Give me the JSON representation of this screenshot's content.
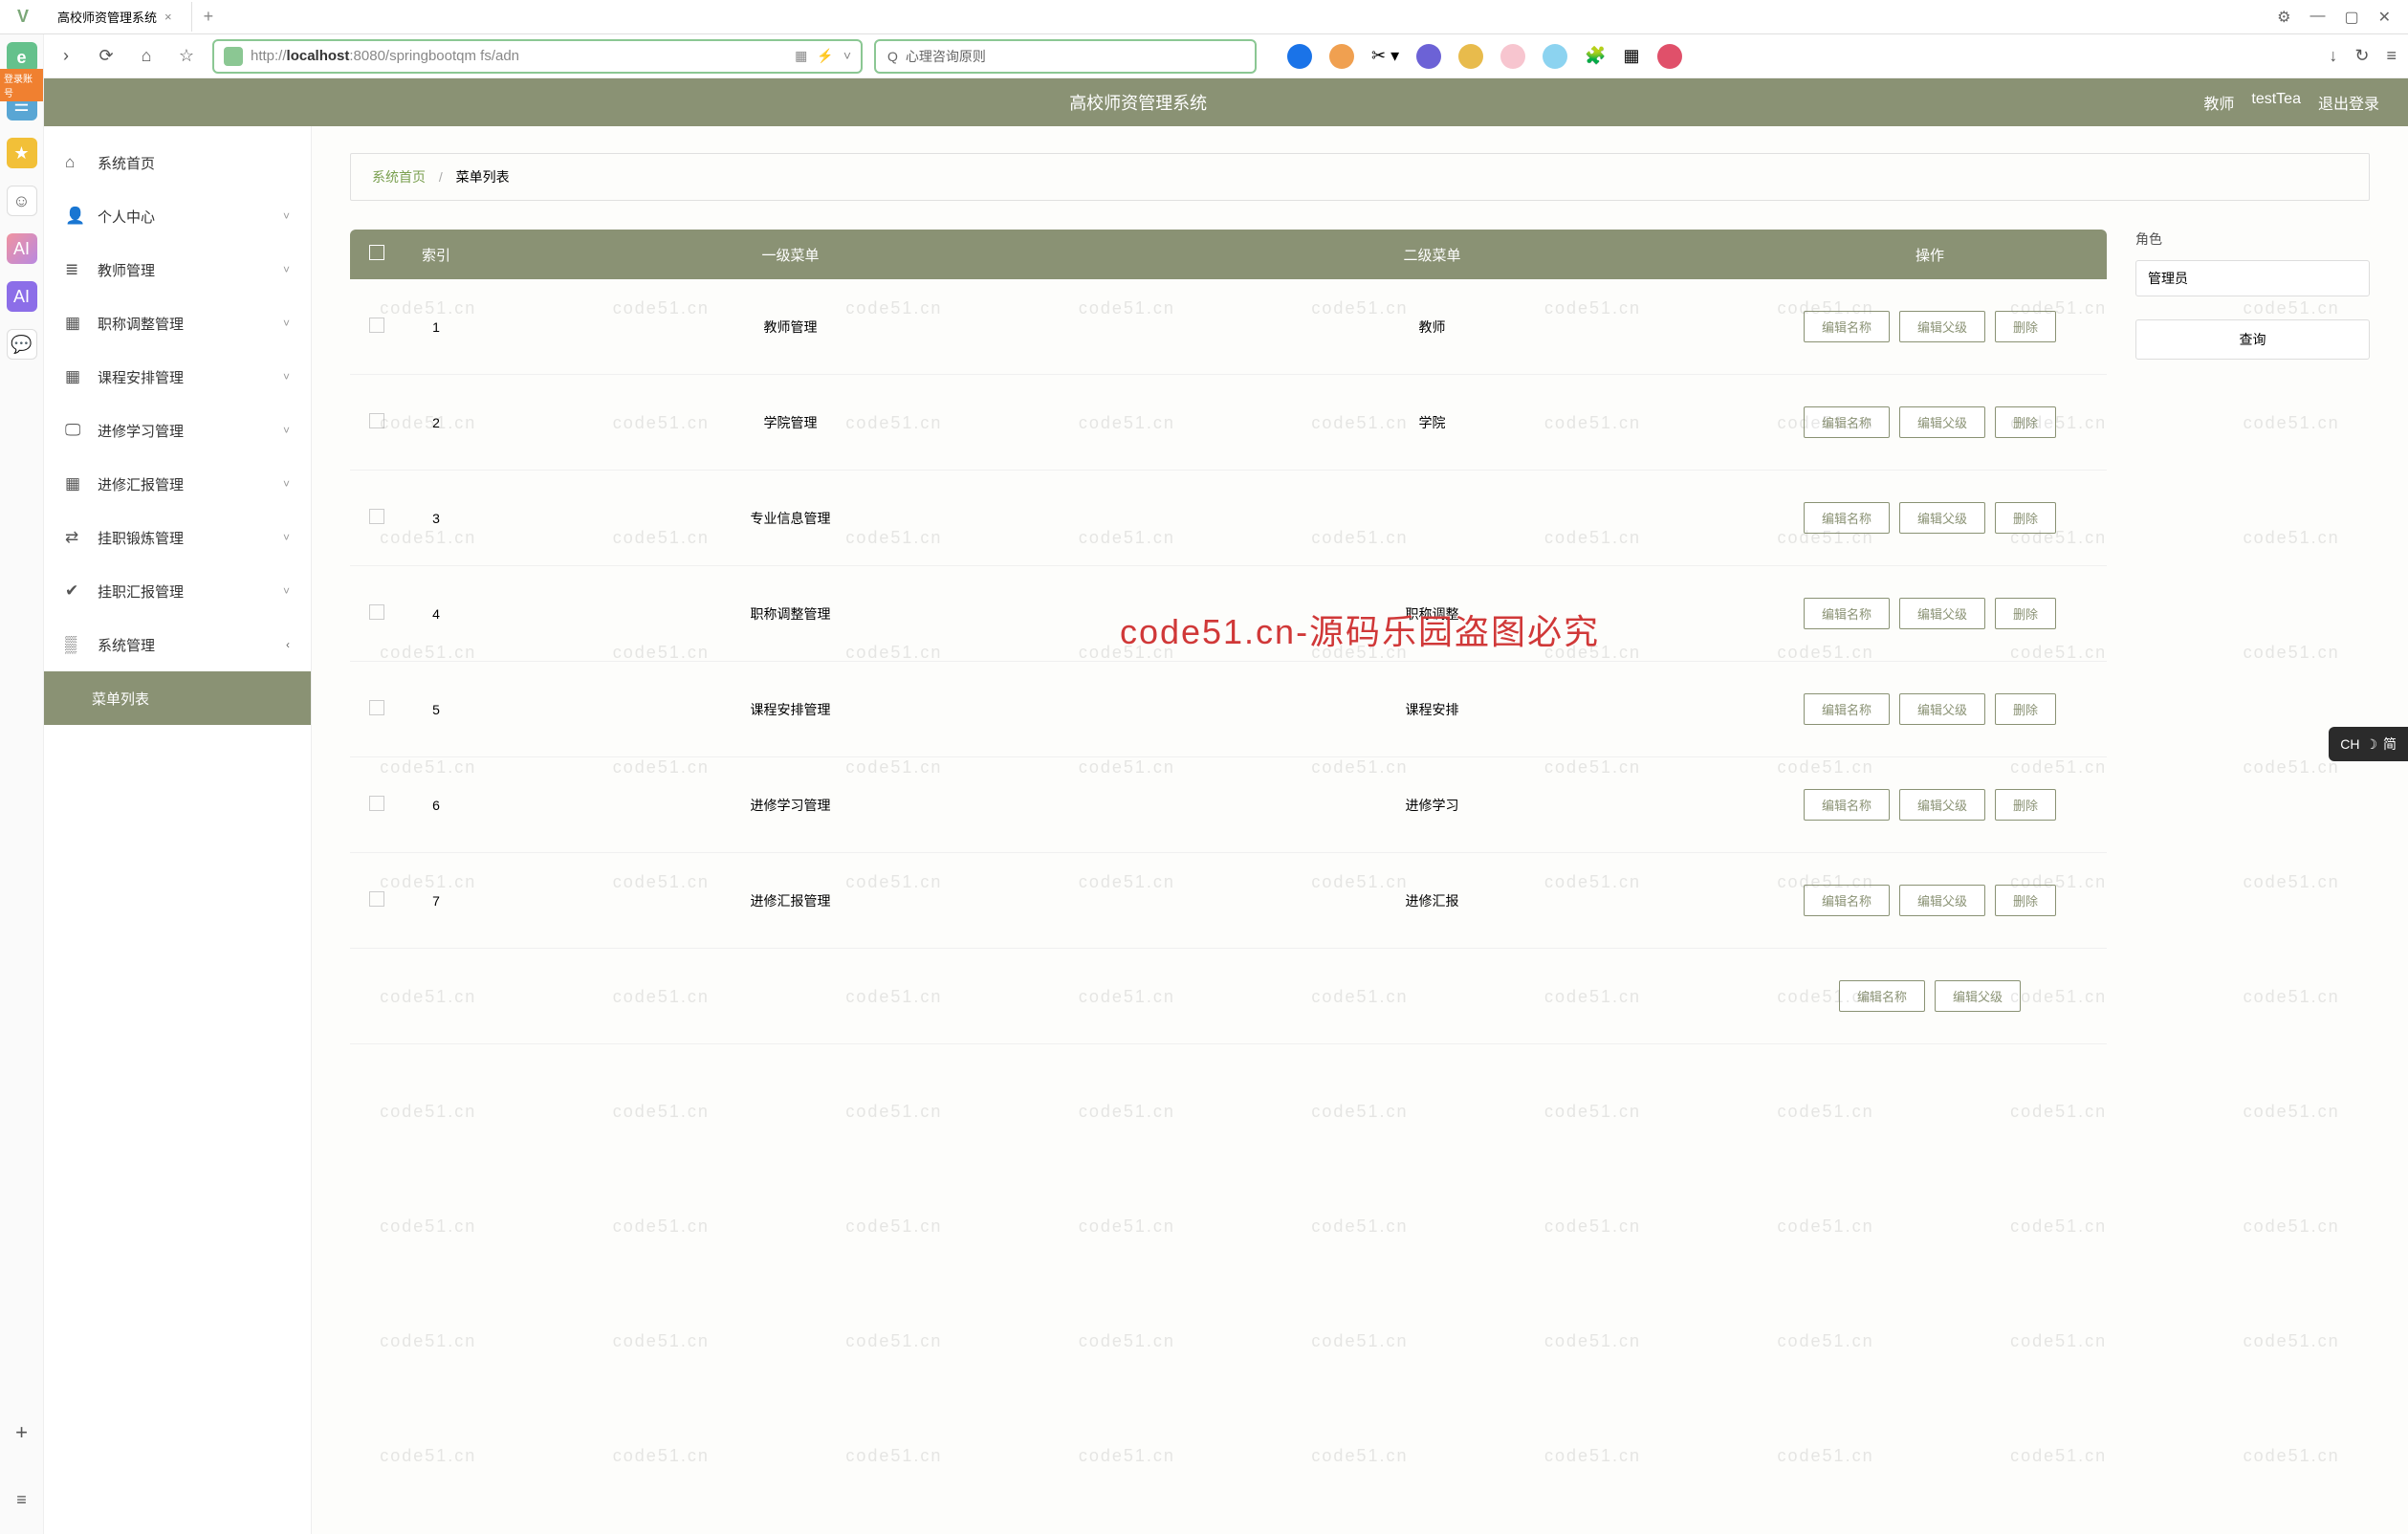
{
  "browser": {
    "tab_title": "高校师资管理系统",
    "url_pre": "http://",
    "url_host": "localhost",
    "url_port_path": ":8080/springbootqm fs/adn",
    "search_placeholder": "心理咨询原则",
    "win_min": "—",
    "win_max": "▢",
    "win_close": "✕"
  },
  "dock": {
    "login_label": "登录账号"
  },
  "header": {
    "title": "高校师资管理系统",
    "role": "教师",
    "user": "testTea",
    "logout": "退出登录"
  },
  "sidebar": {
    "items": [
      {
        "icon": "⌂",
        "label": "系统首页",
        "expand": ""
      },
      {
        "icon": "👤",
        "label": "个人中心",
        "expand": "˅"
      },
      {
        "icon": "≣",
        "label": "教师管理",
        "expand": "˅"
      },
      {
        "icon": "▦",
        "label": "职称调整管理",
        "expand": "˅"
      },
      {
        "icon": "▦",
        "label": "课程安排管理",
        "expand": "˅"
      },
      {
        "icon": "🖵",
        "label": "进修学习管理",
        "expand": "˅"
      },
      {
        "icon": "▦",
        "label": "进修汇报管理",
        "expand": "˅"
      },
      {
        "icon": "⇄",
        "label": "挂职锻炼管理",
        "expand": "˅"
      },
      {
        "icon": "✔",
        "label": "挂职汇报管理",
        "expand": "˅"
      },
      {
        "icon": "▒",
        "label": "系统管理",
        "expand": "‹"
      }
    ],
    "sub_active": "菜单列表"
  },
  "breadcrumb": {
    "home": "系统首页",
    "sep": "/",
    "current": "菜单列表"
  },
  "table": {
    "headers": {
      "idx": "索引",
      "c1": "一级菜单",
      "c2": "二级菜单",
      "op": "操作"
    },
    "btns": {
      "edit_name": "编辑名称",
      "edit_parent": "编辑父级",
      "del": "删除"
    },
    "rows": [
      {
        "idx": "1",
        "c1": "教师管理",
        "c2": "教师"
      },
      {
        "idx": "2",
        "c1": "学院管理",
        "c2": "学院"
      },
      {
        "idx": "3",
        "c1": "专业信息管理",
        "c2": ""
      },
      {
        "idx": "4",
        "c1": "职称调整管理",
        "c2": "职称调整"
      },
      {
        "idx": "5",
        "c1": "课程安排管理",
        "c2": "课程安排"
      },
      {
        "idx": "6",
        "c1": "进修学习管理",
        "c2": "进修学习"
      },
      {
        "idx": "7",
        "c1": "进修汇报管理",
        "c2": "进修汇报"
      }
    ]
  },
  "panel": {
    "role_label": "角色",
    "role_value": "管理员",
    "search_btn": "查询"
  },
  "watermark": {
    "text": "code51.cn",
    "red": "code51.cn-源码乐园盗图必究"
  },
  "ime": {
    "label": "CH",
    "sym": "☽",
    "mode": "简"
  }
}
